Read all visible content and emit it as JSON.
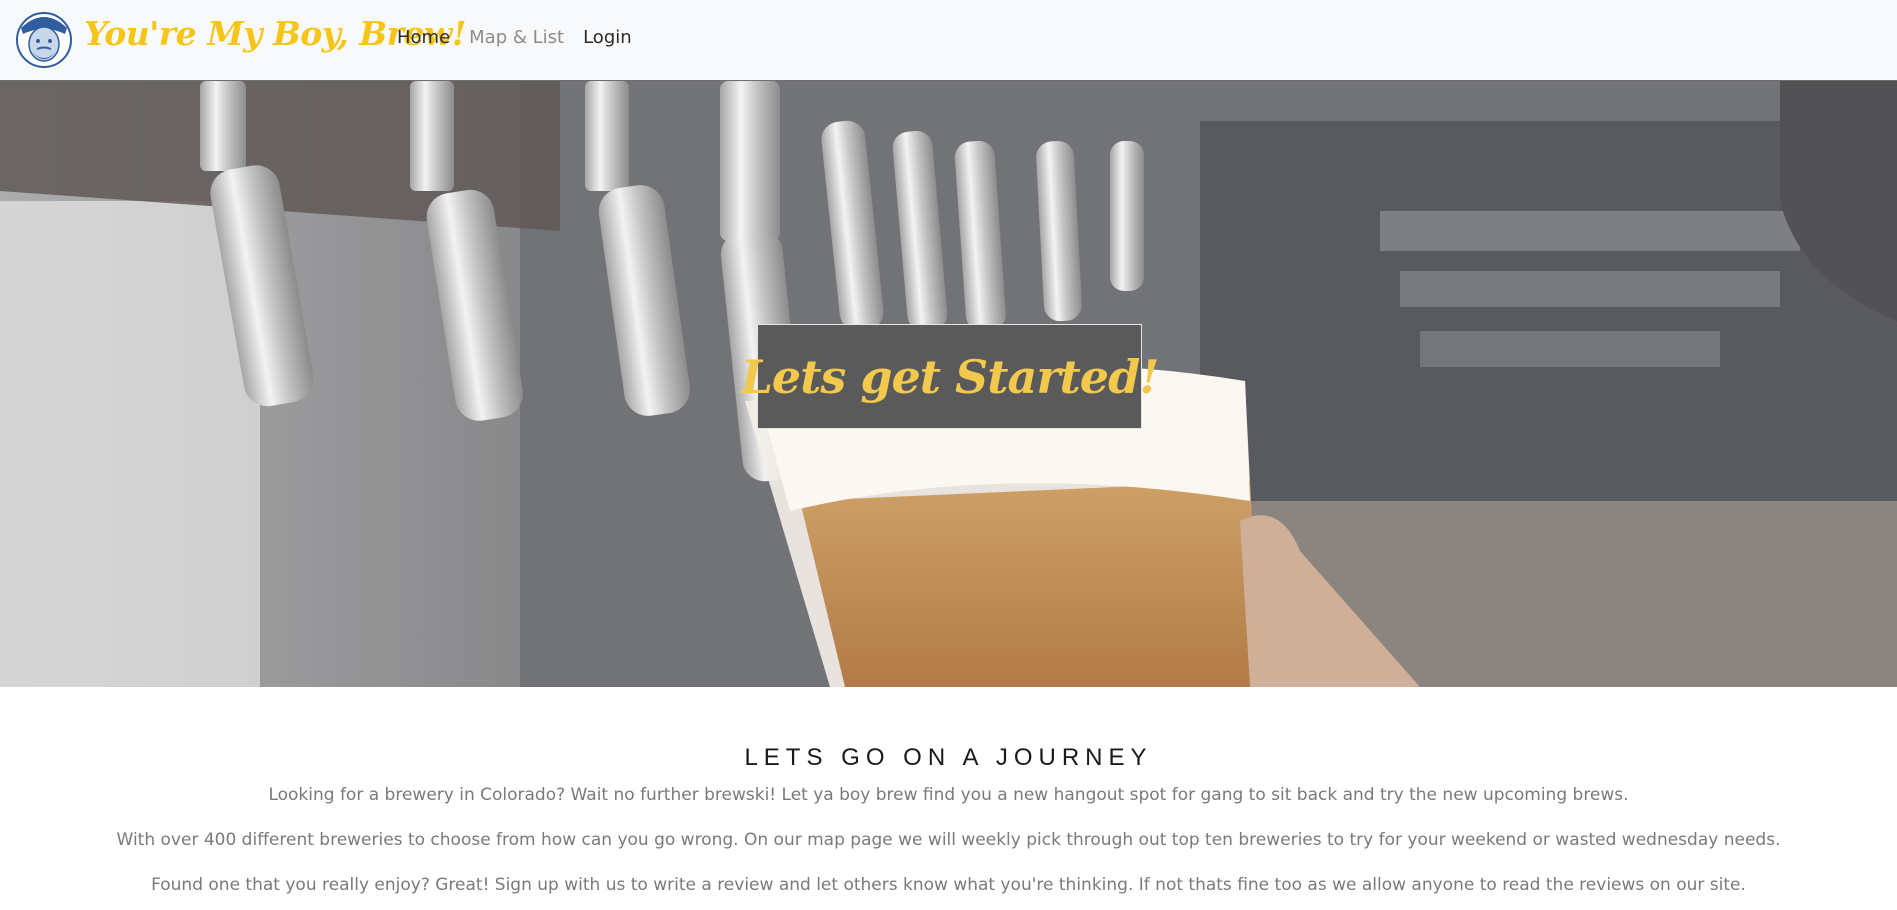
{
  "navbar": {
    "brand": "You're My Boy, Brew!",
    "links": [
      {
        "label": "Home",
        "active": true
      },
      {
        "label": "Map & List",
        "active": false
      },
      {
        "label": "Login",
        "active": false
      }
    ]
  },
  "hero": {
    "title": "Lets get Started!"
  },
  "intro": {
    "heading": "LETS GO ON A JOURNEY",
    "paragraphs": [
      "Looking for a brewery in Colorado? Wait no further brewski! Let ya boy brew find you a new hangout spot for gang to sit back and try the new upcoming brews.",
      "With over 400 different breweries to choose from how can you go wrong. On our map page we will weekly pick through out top ten breweries to try for your weekend or wasted wednesday needs.",
      "Found one that you really enjoy? Great! Sign up with us to write a review and let others know what you're thinking. If not thats fine too as we allow anyone to read the reviews on our site."
    ]
  },
  "colors": {
    "brand": "#f5c518",
    "hero_title": "#f2c94c",
    "navbar_bg": "#f8f9fa",
    "body_text": "#7a7a7a"
  }
}
